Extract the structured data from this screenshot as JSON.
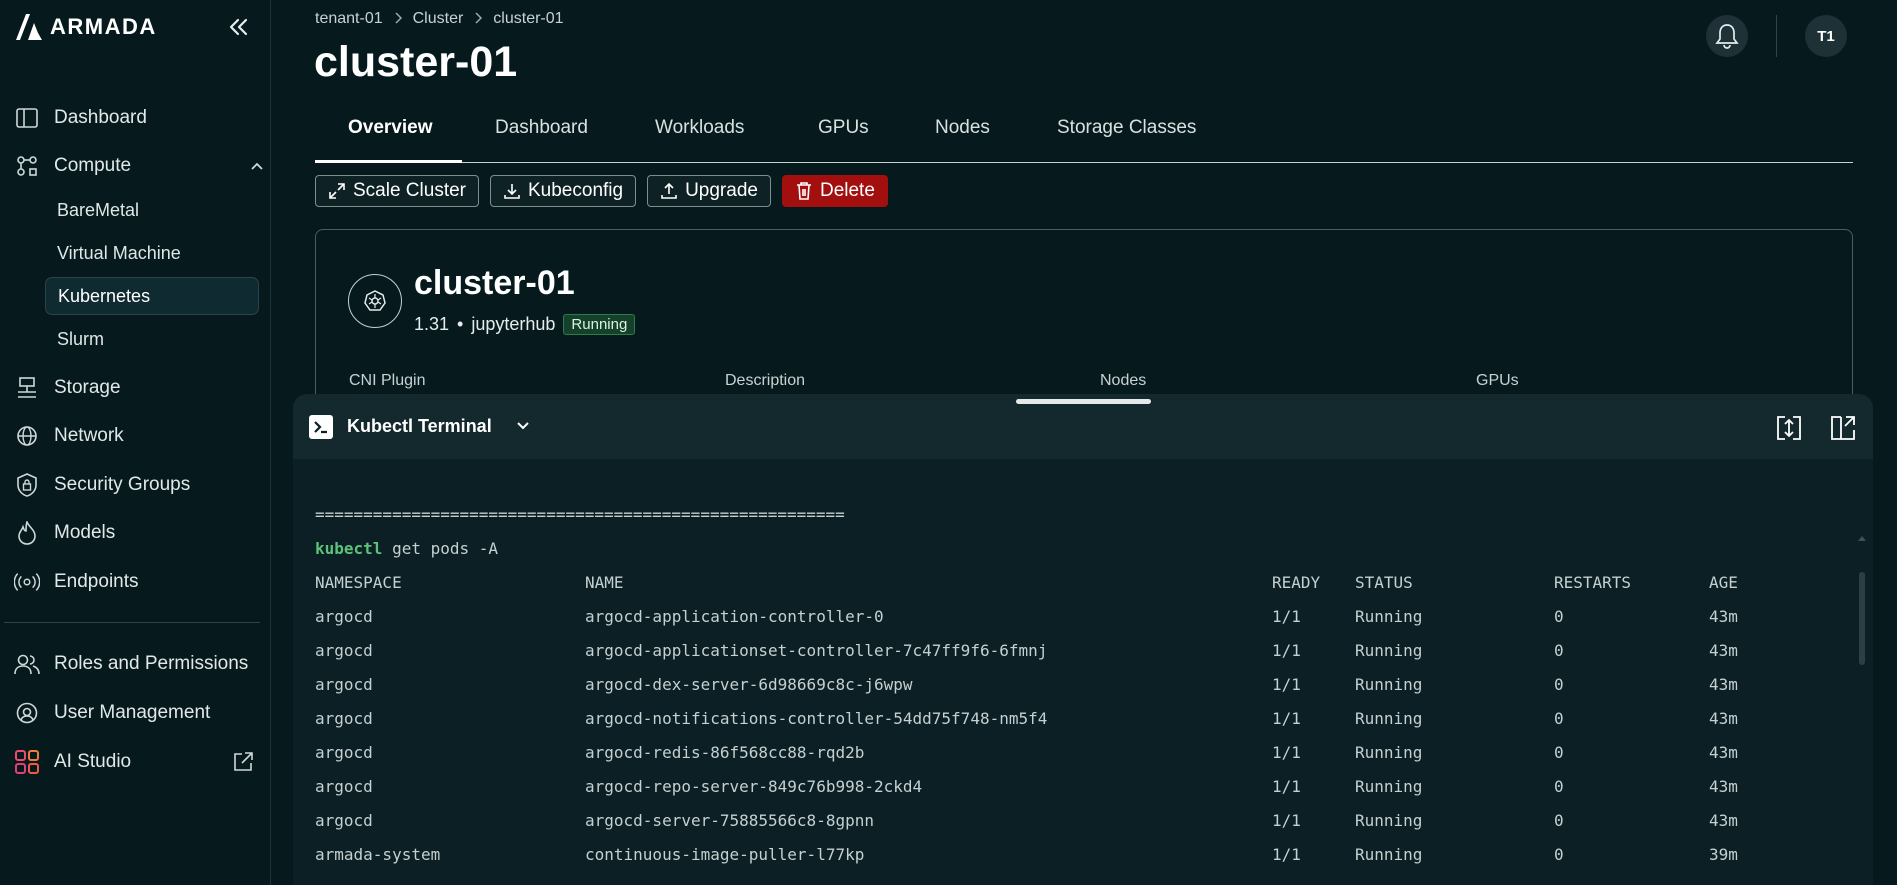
{
  "brand": {
    "name": "ARMADA"
  },
  "sidebar": {
    "items": [
      {
        "label": "Dashboard",
        "icon": "dashboard-icon"
      },
      {
        "label": "Compute",
        "icon": "compute-icon"
      },
      {
        "label": "Storage",
        "icon": "storage-icon"
      },
      {
        "label": "Network",
        "icon": "network-icon"
      },
      {
        "label": "Security Groups",
        "icon": "shield-icon"
      },
      {
        "label": "Models",
        "icon": "flame-icon"
      },
      {
        "label": "Endpoints",
        "icon": "broadcast-icon"
      },
      {
        "label": "Roles and Permissions",
        "icon": "users-icon"
      },
      {
        "label": "User Management",
        "icon": "user-gear-icon"
      },
      {
        "label": "AI Studio",
        "icon": "grid-apps-icon"
      }
    ],
    "compute_sub": [
      "BareMetal",
      "Virtual Machine",
      "Kubernetes",
      "Slurm"
    ],
    "active_sub": "Kubernetes"
  },
  "breadcrumb": [
    "tenant-01",
    "Cluster",
    "cluster-01"
  ],
  "page_title": "cluster-01",
  "user": {
    "initials": "T1"
  },
  "tabs": [
    "Overview",
    "Dashboard",
    "Workloads",
    "GPUs",
    "Nodes",
    "Storage Classes"
  ],
  "active_tab": "Overview",
  "actions": {
    "scale": "Scale Cluster",
    "kubeconfig": "Kubeconfig",
    "upgrade": "Upgrade",
    "delete": "Delete"
  },
  "cluster": {
    "name": "cluster-01",
    "version": "1.31",
    "separator": "•",
    "app": "jupyterhub",
    "status": "Running",
    "fields": [
      "CNI Plugin",
      "Description",
      "Nodes",
      "GPUs"
    ]
  },
  "terminal": {
    "title": "Kubectl Terminal",
    "divider": "=======================================================",
    "command_kw": "kubectl",
    "command_rest": " get pods -A",
    "headers": [
      "NAMESPACE",
      "NAME",
      "READY",
      "STATUS",
      "RESTARTS",
      "AGE"
    ],
    "rows": [
      [
        "argocd",
        "argocd-application-controller-0",
        "1/1",
        "Running",
        "0",
        "43m"
      ],
      [
        "argocd",
        "argocd-applicationset-controller-7c47ff9f6-6fmnj",
        "1/1",
        "Running",
        "0",
        "43m"
      ],
      [
        "argocd",
        "argocd-dex-server-6d98669c8c-j6wpw",
        "1/1",
        "Running",
        "0",
        "43m"
      ],
      [
        "argocd",
        "argocd-notifications-controller-54dd75f748-nm5f4",
        "1/1",
        "Running",
        "0",
        "43m"
      ],
      [
        "argocd",
        "argocd-redis-86f568cc88-rqd2b",
        "1/1",
        "Running",
        "0",
        "43m"
      ],
      [
        "argocd",
        "argocd-repo-server-849c76b998-2ckd4",
        "1/1",
        "Running",
        "0",
        "43m"
      ],
      [
        "argocd",
        "argocd-server-75885566c8-8gpnn",
        "1/1",
        "Running",
        "0",
        "43m"
      ],
      [
        "armada-system",
        "continuous-image-puller-l77kp",
        "1/1",
        "Running",
        "0",
        "39m"
      ]
    ]
  },
  "colors": {
    "danger": "#a30f0f",
    "running_badge": "#15402a",
    "kubectl": "#5cc27a"
  }
}
